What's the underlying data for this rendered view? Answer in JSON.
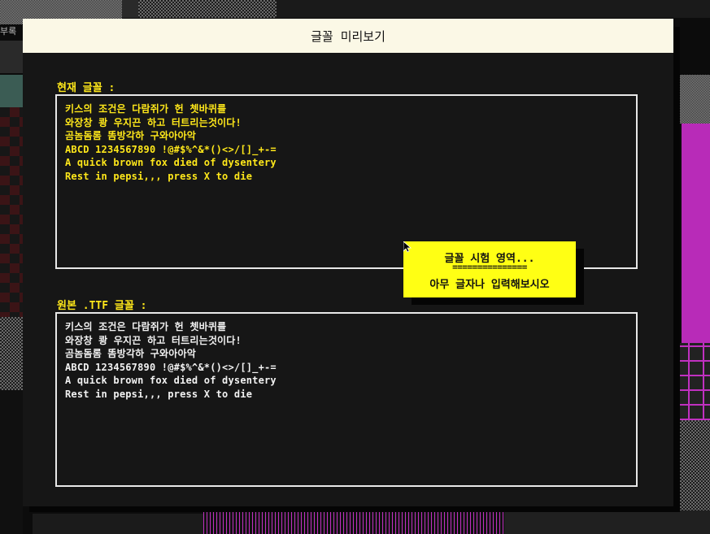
{
  "dialog": {
    "title": "글꼴 미리보기"
  },
  "current_font": {
    "label": "현재 글꼴 :",
    "lines": [
      "키스의 조건은 다람쥐가 헌 쳇바퀴를",
      "와장창 쾅 우지끈 하고 터트리는것이다!",
      "곰놈돔롬 똠방각하 구와아아악",
      "ABCD 1234567890 !@#$%^&*()<>/[]_+-=",
      "A quick brown fox died of dysentery",
      "Rest in pepsi,,, press X to die"
    ]
  },
  "original_font": {
    "label": "원본 .TTF 글꼴 :",
    "lines": [
      "키스의 조건은 다람쥐가 헌 쳇바퀴를",
      "와장창 쾅 우지끈 하고 터트리는것이다!",
      "곰놈돔롬 똠방각하 구와아아악",
      "ABCD 1234567890 !@#$%^&*()<>/[]_+-=",
      "A quick brown fox died of dysentery",
      "Rest in pepsi,,, press X to die"
    ]
  },
  "tooltip": {
    "line1": "글꼴 시험 영역...",
    "line2": "===============",
    "line3": "아무 글자나 입력해보시오"
  },
  "background": {
    "corner_text": "부록"
  },
  "colors": {
    "dialog_bg": "#161616",
    "titlebar_bg": "#fbf8e6",
    "current_text": "#ffe81a",
    "original_text": "#f2f2f2",
    "tooltip_bg": "#ffff14"
  },
  "icons": {
    "cursor": "mouse-pointer-icon"
  }
}
